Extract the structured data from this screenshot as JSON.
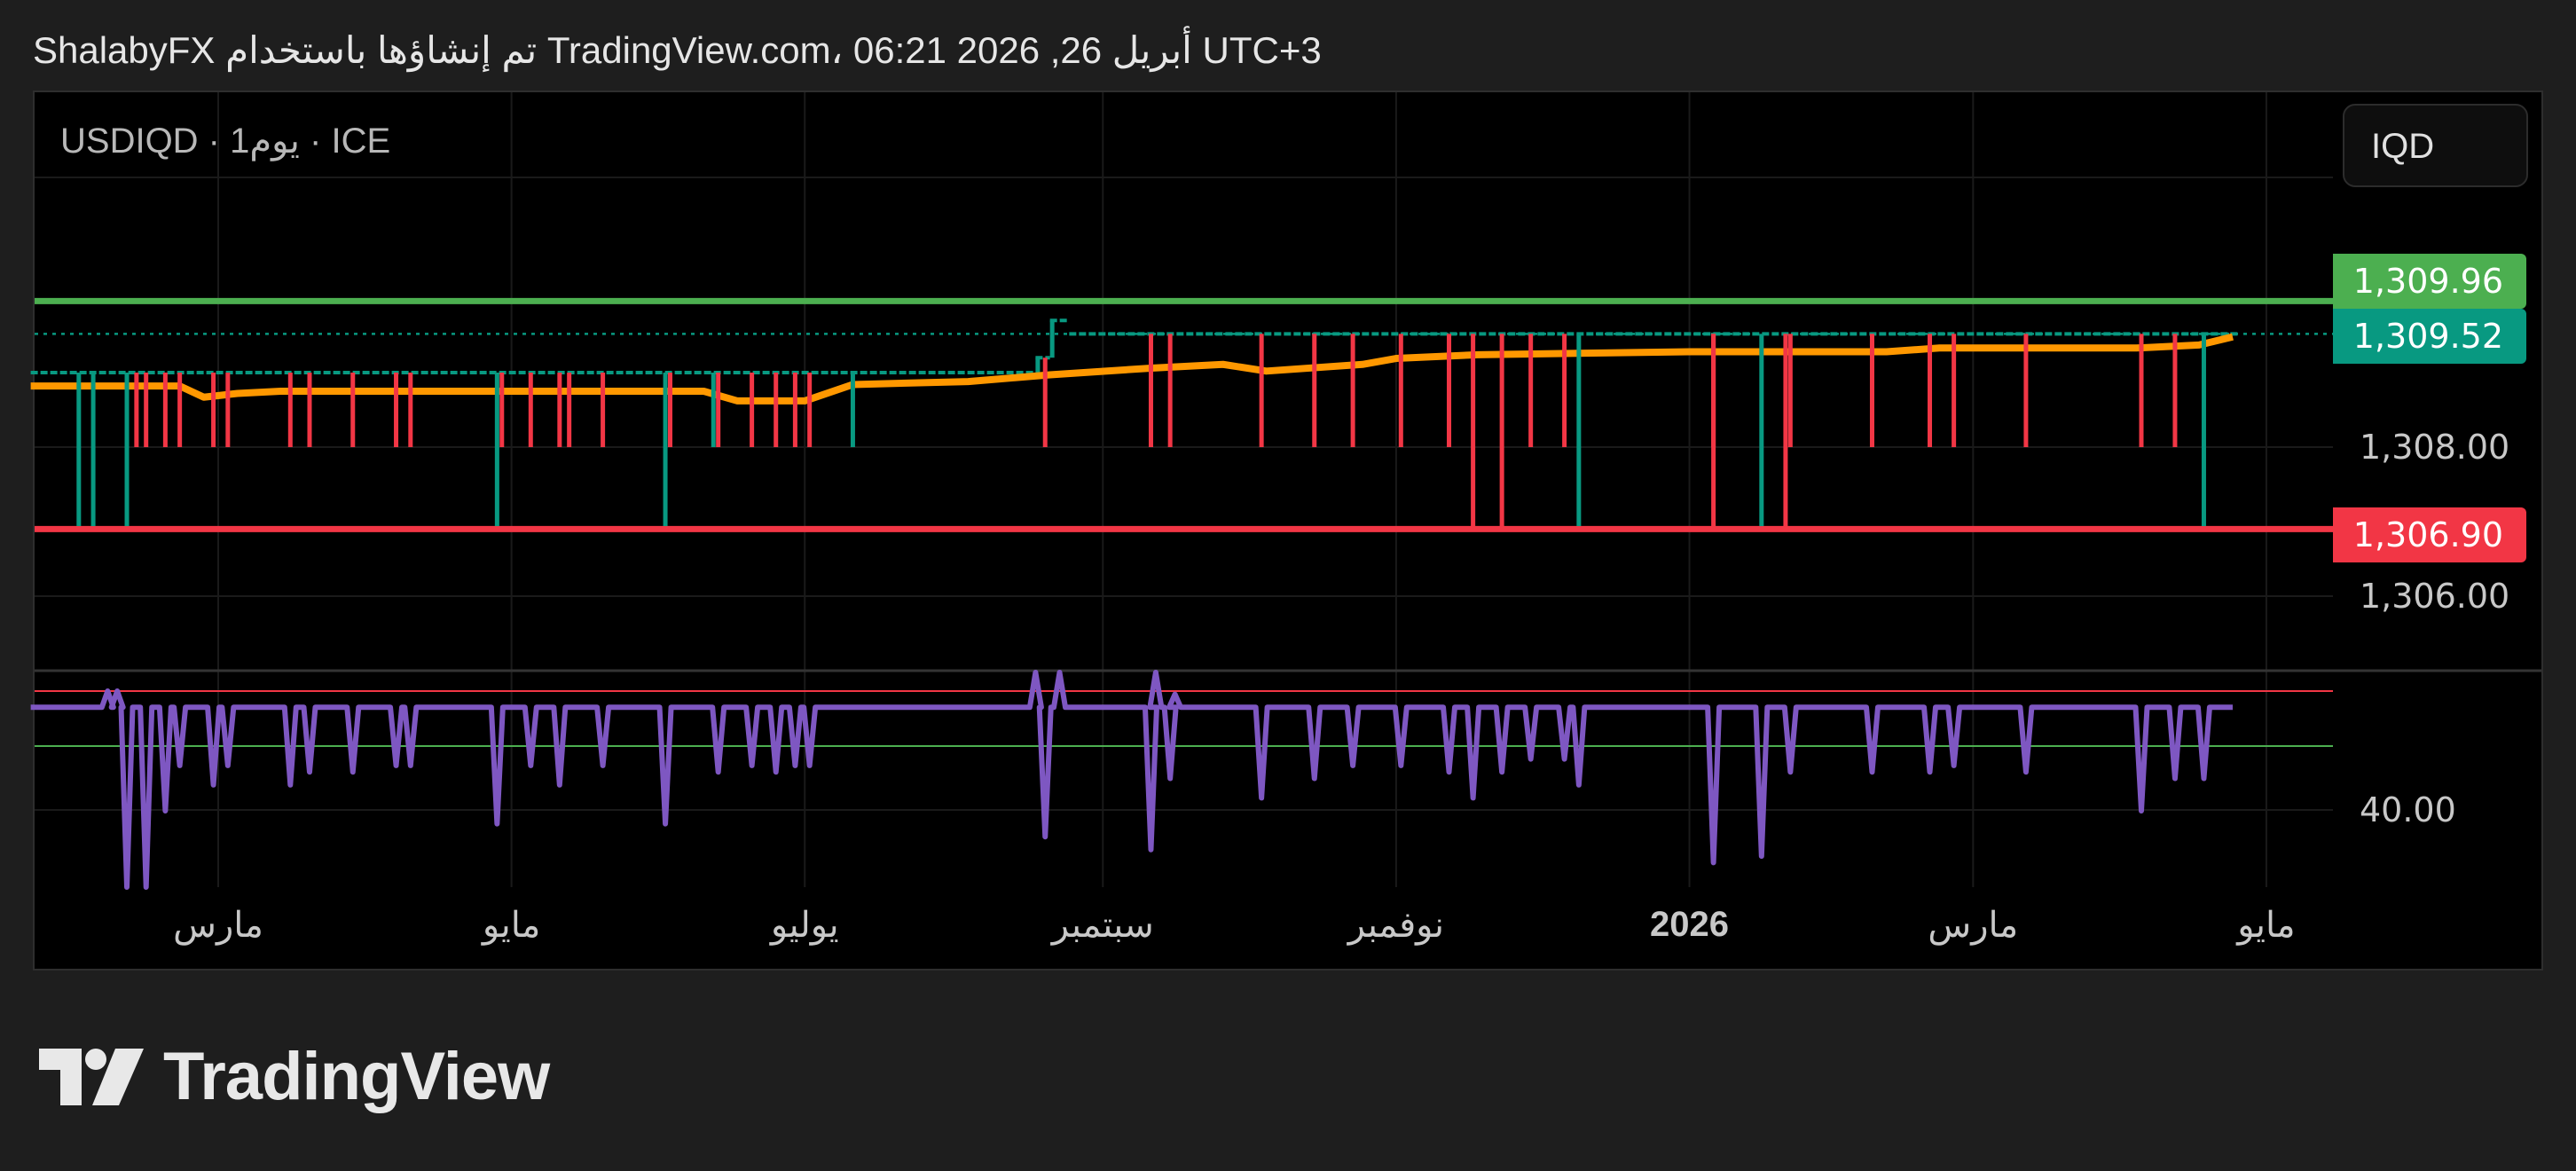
{
  "header": {
    "parts": [
      "ShalabyFX",
      "تم إنشاؤها باستخدام",
      "TradingView.com، 06:21 2026 ,26",
      "أبريل",
      "UTC+3"
    ]
  },
  "legend": {
    "symbol": "USDIQD · 1",
    "interval": "يوم",
    "exchange": " · ICE"
  },
  "currency_button": "IQD",
  "price_labels": {
    "high": "1,309.96",
    "last": "1,309.52",
    "low": "1,306.90"
  },
  "axis_labels": {
    "p1308": "1,308.00",
    "p1306": "1,306.00",
    "rsi40": "40.00"
  },
  "time_labels": [
    {
      "text": "مارس",
      "day": 0
    },
    {
      "text": "مايو",
      "day": 61
    },
    {
      "text": "يوليو",
      "day": 122
    },
    {
      "text": "سبتمبر",
      "day": 184
    },
    {
      "text": "نوفمبر",
      "day": 245
    },
    {
      "text": "2026",
      "day": 306,
      "bold": true
    },
    {
      "text": "مارس",
      "day": 365
    },
    {
      "text": "مايو",
      "day": 426
    }
  ],
  "logo": {
    "text": "TradingView"
  },
  "colors": {
    "up": "#089981",
    "down": "#f23645",
    "ma": "#ff9800",
    "rsi": "#7e57c2",
    "high": "#4caf50",
    "low": "#f23645",
    "bg": "#000000"
  },
  "chart_data": {
    "type": "candlestick",
    "title": "USDIQD · 1D · ICE",
    "x_unit": "days since 2025-03-01",
    "xlim": [
      -39,
      440
    ],
    "ylim": [
      1305.0,
      1311.7
    ],
    "levels": {
      "high": 1309.96,
      "low": 1306.9,
      "last": 1309.52
    },
    "close_segments": [
      [
        -39,
        169,
        1309.0
      ],
      [
        170,
        172,
        1309.2
      ],
      [
        173,
        176,
        1309.7
      ],
      [
        177,
        419,
        1309.52
      ]
    ],
    "spikes": {
      "red_short": [
        -17,
        -15,
        -11,
        -8,
        -1,
        2,
        15,
        19,
        28,
        37,
        40,
        59,
        65,
        71,
        73,
        80,
        94,
        104,
        111,
        116,
        120,
        123,
        172,
        194,
        198,
        217,
        228,
        236,
        246,
        256,
        273,
        280,
        311,
        327,
        344,
        356,
        361,
        376,
        400,
        407
      ],
      "red_long": [
        261,
        267,
        311,
        326
      ],
      "green_long": [
        -29,
        -26,
        -19,
        58,
        93,
        283,
        321,
        413
      ],
      "green_short": [
        103,
        132
      ],
      "short_low": 1308.0,
      "long_low": 1306.94
    },
    "ma": [
      [
        -39,
        1308.82
      ],
      [
        -8,
        1308.82
      ],
      [
        -3,
        1308.67
      ],
      [
        4,
        1308.72
      ],
      [
        13,
        1308.75
      ],
      [
        57,
        1308.75
      ],
      [
        101,
        1308.75
      ],
      [
        108,
        1308.62
      ],
      [
        122,
        1308.62
      ],
      [
        132,
        1308.84
      ],
      [
        156,
        1308.88
      ],
      [
        173,
        1308.97
      ],
      [
        194,
        1309.06
      ],
      [
        209,
        1309.11
      ],
      [
        218,
        1309.02
      ],
      [
        238,
        1309.11
      ],
      [
        245,
        1309.19
      ],
      [
        262,
        1309.24
      ],
      [
        306,
        1309.28
      ],
      [
        347,
        1309.28
      ],
      [
        358,
        1309.33
      ],
      [
        399,
        1309.33
      ],
      [
        412,
        1309.37
      ],
      [
        419,
        1309.48
      ]
    ],
    "rsi": {
      "baseline": 56,
      "upper_band": 58.5,
      "lower_band": 50,
      "ylim": [
        30,
        72
      ],
      "dips": [
        [
          -19,
          28
        ],
        [
          -15,
          28
        ],
        [
          -11,
          40
        ],
        [
          -8,
          47
        ],
        [
          -1,
          44
        ],
        [
          2,
          47
        ],
        [
          15,
          44
        ],
        [
          19,
          46
        ],
        [
          28,
          46
        ],
        [
          37,
          47
        ],
        [
          40,
          47
        ],
        [
          58,
          38
        ],
        [
          65,
          47
        ],
        [
          71,
          44
        ],
        [
          80,
          47
        ],
        [
          93,
          38
        ],
        [
          104,
          46
        ],
        [
          111,
          47
        ],
        [
          116,
          46
        ],
        [
          120,
          47
        ],
        [
          123,
          47
        ],
        [
          172,
          36
        ],
        [
          194,
          34
        ],
        [
          198,
          45
        ],
        [
          217,
          42
        ],
        [
          228,
          45
        ],
        [
          236,
          47
        ],
        [
          246,
          47
        ],
        [
          256,
          46
        ],
        [
          261,
          42
        ],
        [
          267,
          46
        ],
        [
          273,
          48
        ],
        [
          280,
          48
        ],
        [
          283,
          44
        ],
        [
          311,
          32
        ],
        [
          321,
          33
        ],
        [
          327,
          46
        ],
        [
          344,
          46
        ],
        [
          356,
          46
        ],
        [
          361,
          47
        ],
        [
          376,
          46
        ],
        [
          400,
          40
        ],
        [
          407,
          45
        ],
        [
          413,
          45
        ]
      ],
      "peaks": [
        [
          -23,
          58.5
        ],
        [
          -21,
          58.5
        ],
        [
          170,
          72
        ],
        [
          175,
          72
        ],
        [
          195,
          72
        ],
        [
          199,
          58
        ]
      ]
    }
  }
}
